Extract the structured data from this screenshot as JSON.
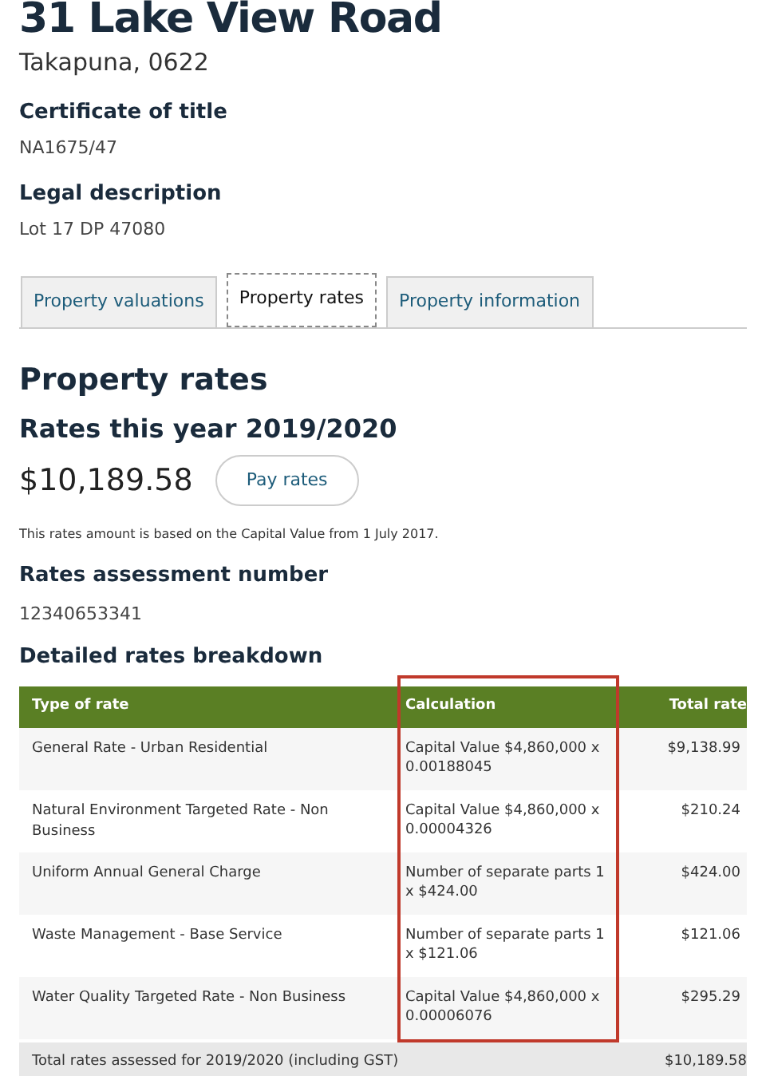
{
  "address": {
    "street": "31 Lake View Road",
    "suburb": "Takapuna, 0622"
  },
  "fields": [
    {
      "label": "Certificate of title",
      "value": "NA1675/47"
    },
    {
      "label": "Legal description",
      "value": "Lot 17 DP 47080"
    }
  ],
  "tabs": [
    {
      "label": "Property valuations",
      "selected": false
    },
    {
      "label": "Property rates",
      "selected": true
    },
    {
      "label": "Property information",
      "selected": false
    }
  ],
  "section_title": "Property rates",
  "rates_year": "Rates this year 2019/2020",
  "amount": "$10,189.58",
  "pay_button": "Pay rates",
  "note": "This rates amount is based on the Capital Value from 1 July 2017.",
  "assessment": {
    "label": "Rates assessment number",
    "value": "12340653341"
  },
  "breakdown_title": "Detailed rates breakdown",
  "table": {
    "columns": [
      "Type of rate",
      "Calculation",
      "Total rate"
    ],
    "rows": [
      [
        "General Rate - Urban Residential",
        "Capital Value $4,860,000 x 0.00188045",
        "$9,138.99"
      ],
      [
        "Natural Environment Targeted Rate - Non Business",
        "Capital Value $4,860,000 x 0.00004326",
        "$210.24"
      ],
      [
        "Uniform Annual General Charge",
        "Number of separate parts 1 x $424.00",
        "$424.00"
      ],
      [
        "Waste Management - Base Service",
        "Number of separate parts 1 x $121.06",
        "$121.06"
      ],
      [
        "Water Quality Targeted Rate - Non Business",
        "Capital Value $4,860,000 x 0.00006076",
        "$295.29"
      ]
    ],
    "total": {
      "label": "Total rates assessed for 2019/2020 (including GST)",
      "value": "$10,189.58"
    }
  }
}
